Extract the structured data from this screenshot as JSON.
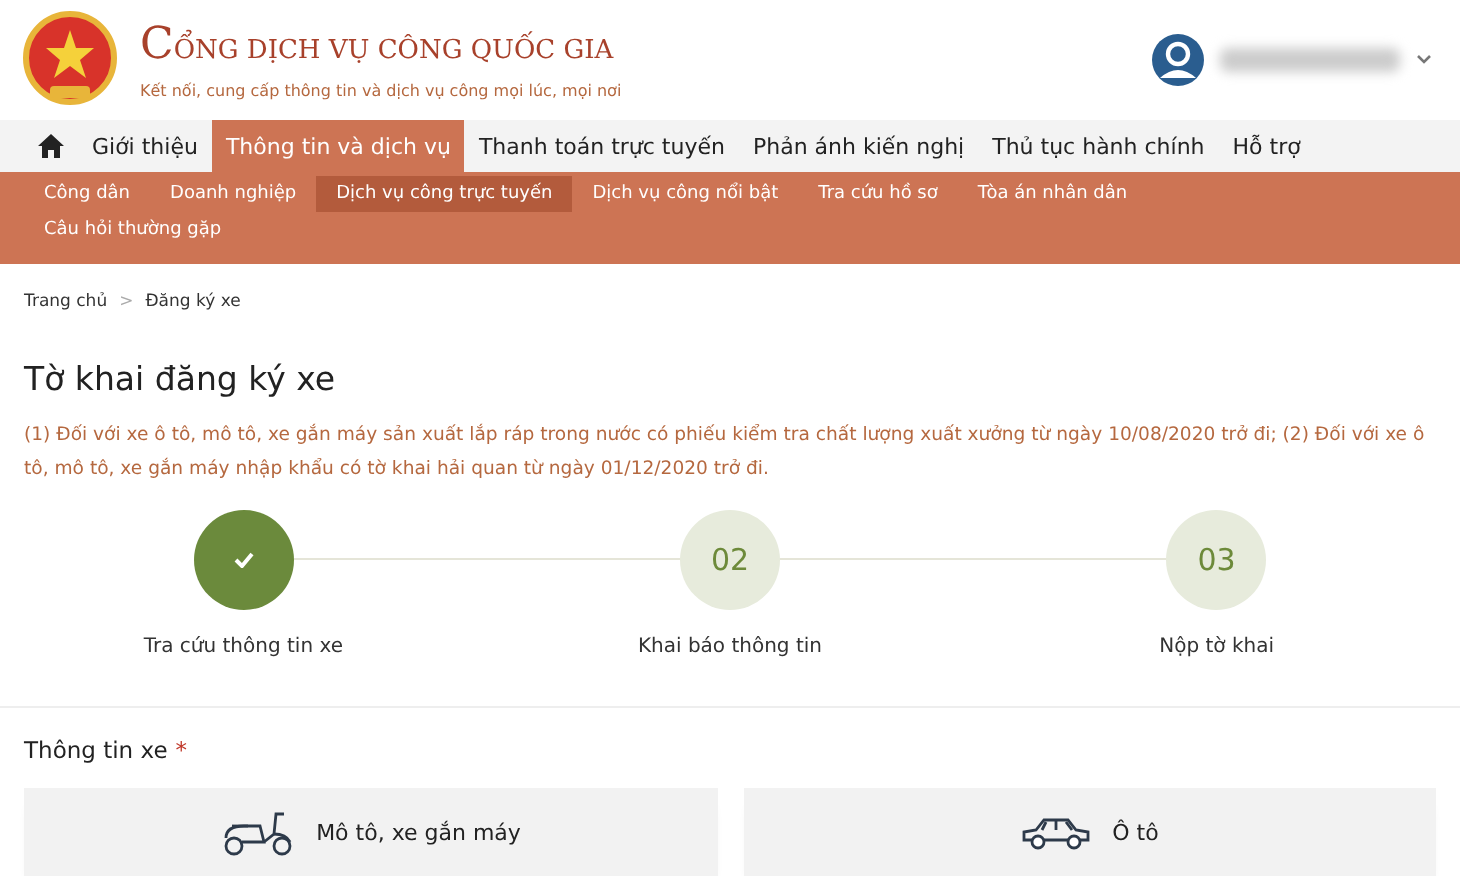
{
  "header": {
    "title": "CỔNG DỊCH VỤ CÔNG QUỐC GIA",
    "tagline": "Kết nối, cung cấp thông tin và dịch vụ công mọi lúc, mọi nơi"
  },
  "main_nav": [
    {
      "kind": "home",
      "selected": false
    },
    {
      "kind": "link",
      "label": "Giới thiệu",
      "selected": false
    },
    {
      "kind": "link",
      "label": "Thông tin và dịch vụ",
      "selected": true
    },
    {
      "kind": "link",
      "label": "Thanh toán trực tuyến",
      "selected": false
    },
    {
      "kind": "link",
      "label": "Phản ánh kiến nghị",
      "selected": false
    },
    {
      "kind": "link",
      "label": "Thủ tục hành chính",
      "selected": false
    },
    {
      "kind": "link",
      "label": "Hỗ trợ",
      "selected": false
    }
  ],
  "sub_nav": [
    {
      "label": "Công dân",
      "selected": false
    },
    {
      "label": "Doanh nghiệp",
      "selected": false
    },
    {
      "label": "Dịch vụ công trực tuyến",
      "selected": true
    },
    {
      "label": "Dịch vụ công nổi bật",
      "selected": false
    },
    {
      "label": "Tra cứu hồ sơ",
      "selected": false
    },
    {
      "label": "Tòa án nhân dân",
      "selected": false
    },
    {
      "label": "Câu hỏi thường gặp",
      "selected": false
    }
  ],
  "breadcrumb": {
    "items": [
      "Trang chủ",
      "Đăng ký xe"
    ],
    "separator": ">"
  },
  "page_title": "Tờ khai đăng ký xe",
  "notice": "(1) Đối với xe ô tô, mô tô, xe gắn máy sản xuất lắp ráp trong nước có phiếu kiểm tra chất lượng xuất xưởng từ ngày 10/08/2020 trở đi; (2) Đối với xe ô tô, mô tô, xe gắn máy nhập khẩu có tờ khai hải quan từ ngày 01/12/2020 trở đi.",
  "steps": [
    {
      "done": true,
      "label": "Tra cứu thông tin xe"
    },
    {
      "done": false,
      "number": "02",
      "label": "Khai báo thông tin"
    },
    {
      "done": false,
      "number": "03",
      "label": "Nộp tờ khai"
    }
  ],
  "vehicle_info": {
    "label": "Thông tin xe",
    "required_marker": "*",
    "options": [
      {
        "kind": "motorbike",
        "label": "Mô tô, xe gắn máy"
      },
      {
        "kind": "car",
        "label": "Ô tô"
      }
    ]
  }
}
